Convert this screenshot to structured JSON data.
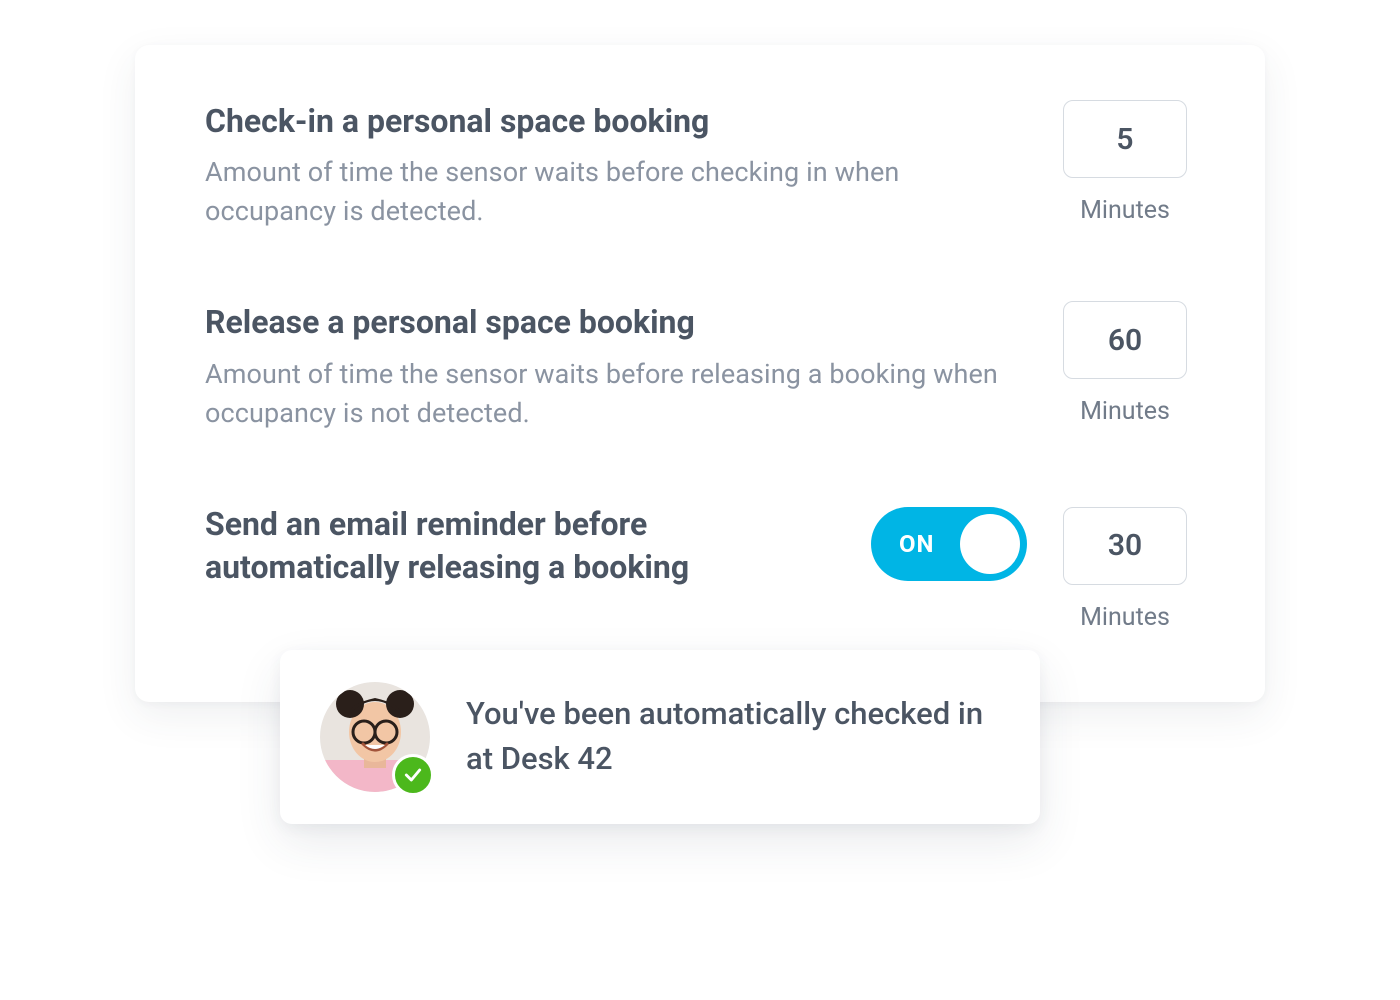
{
  "settings": [
    {
      "title": "Check-in a personal space booking",
      "description": "Amount of time the sensor waits before checking in when occupancy is detected.",
      "value": "5",
      "unit": "Minutes"
    },
    {
      "title": "Release a personal space booking",
      "description": "Amount of time the sensor waits before releasing a booking when occupancy is not detected.",
      "value": "60",
      "unit": "Minutes"
    },
    {
      "title": "Send an email reminder before automatically releasing a booking",
      "toggle_state": "ON",
      "value": "30",
      "unit": "Minutes"
    }
  ],
  "toast": {
    "message": "You've been automatically checked in at Desk 42"
  }
}
